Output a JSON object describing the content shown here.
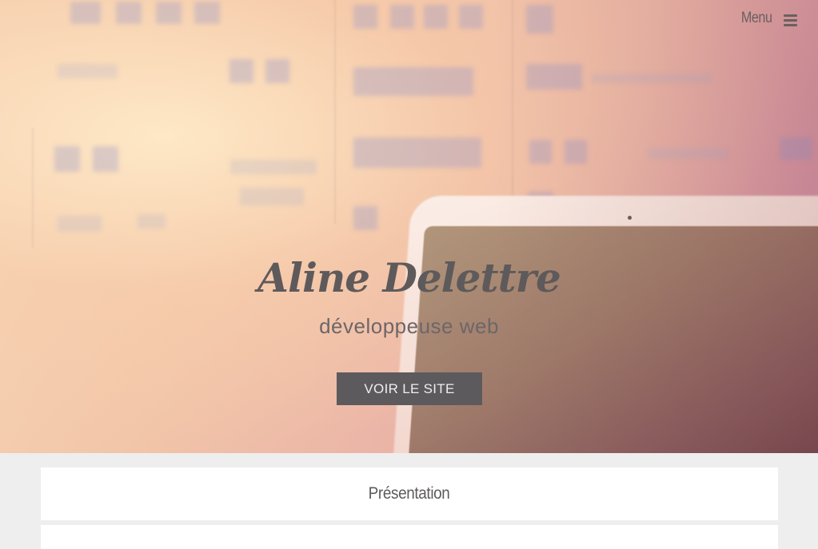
{
  "nav": {
    "menu_label": "Menu",
    "menu_icon": "hamburger-icon"
  },
  "hero": {
    "title": "Aline Delettre",
    "subtitle": "développeuse web",
    "cta_label": "VOIR LE SITE"
  },
  "sections": [
    {
      "title": "Présentation"
    },
    {
      "title": ""
    }
  ],
  "colors": {
    "text_dark": "#5e5a5b",
    "button_bg": "#5d5a5d",
    "button_text": "#f1eded",
    "page_bg": "#eeeeee",
    "card_bg": "#ffffff"
  }
}
